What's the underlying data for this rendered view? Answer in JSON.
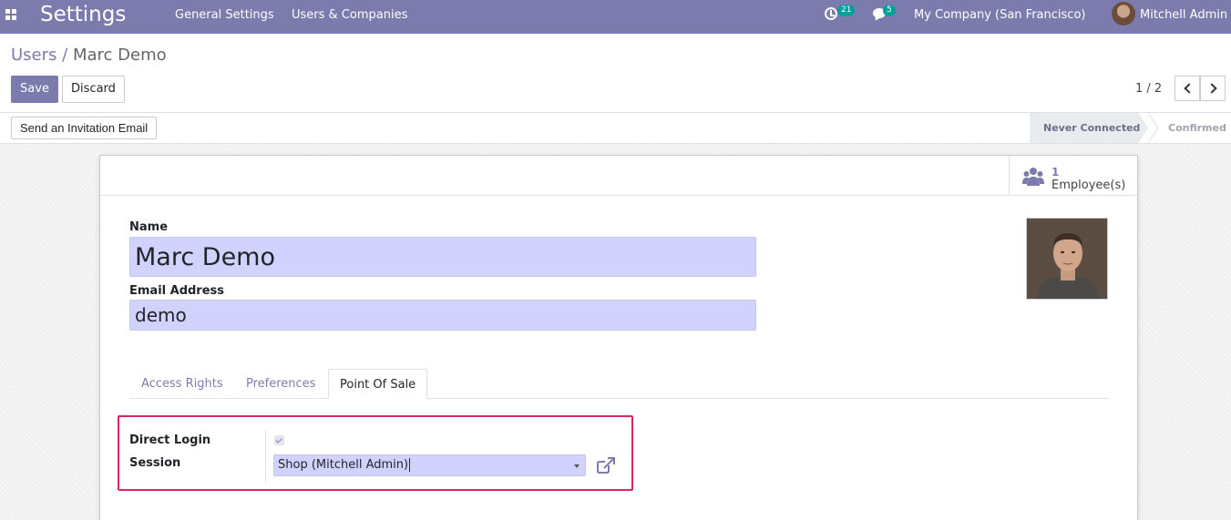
{
  "navbar": {
    "app_title": "Settings",
    "menu": [
      "General Settings",
      "Users & Companies"
    ],
    "activities_count": "21",
    "messages_count": "5",
    "company": "My Company (San Francisco)",
    "user": "Mitchell Admin",
    "accent_color": "#7c7bad",
    "badge_color": "#00a09d"
  },
  "breadcrumb": {
    "parent": "Users",
    "separator": "/",
    "current": "Marc Demo"
  },
  "toolbar": {
    "save_label": "Save",
    "discard_label": "Discard"
  },
  "pager": {
    "value": "1 / 2"
  },
  "statusbar": {
    "invite_label": "Send an Invitation Email",
    "stages": [
      "Never Connected",
      "Confirmed"
    ],
    "active_stage": "Never Connected"
  },
  "smart_button": {
    "value": "1",
    "label": "Employee(s)",
    "icon": "users-icon"
  },
  "form": {
    "name_label": "Name",
    "name_value": "Marc Demo",
    "email_label": "Email Address",
    "email_value": "demo"
  },
  "tabs": {
    "items": [
      "Access Rights",
      "Preferences",
      "Point Of Sale"
    ],
    "active": "Point Of Sale"
  },
  "pos": {
    "direct_login_label": "Direct Login",
    "direct_login_checked": true,
    "session_label": "Session",
    "session_value": "Shop (Mitchell Admin)",
    "highlight_color": "#e0245e"
  }
}
